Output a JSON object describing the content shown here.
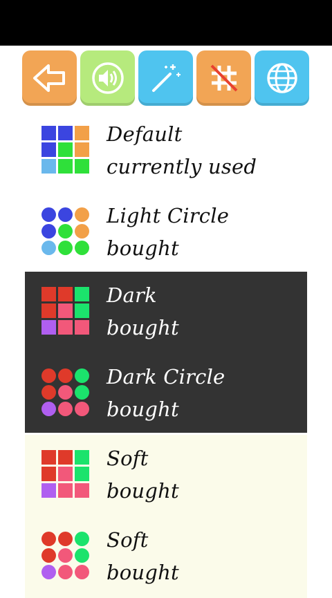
{
  "toolbar": {
    "buttons": [
      {
        "icon": "back-arrow-icon",
        "color": "#f2a555"
      },
      {
        "icon": "speaker-icon",
        "color": "#b6ea7d"
      },
      {
        "icon": "magic-wand-icon",
        "color": "#4fc4ef"
      },
      {
        "icon": "grid-off-icon",
        "color": "#f2a555"
      },
      {
        "icon": "globe-icon",
        "color": "#4fc4ef"
      }
    ]
  },
  "themes": [
    {
      "name": "Default",
      "status": "currently used",
      "shape": "square",
      "bg": "#ffffff",
      "text": "#111111",
      "colors": [
        "#3b45e0",
        "#3b45e0",
        "#f2a048",
        "#3b45e0",
        "#2fe03a",
        "#f2a048",
        "#6ab8ec",
        "#2fe03a",
        "#2fe03a"
      ]
    },
    {
      "name": "Light Circle",
      "status": "bought",
      "shape": "circle",
      "bg": "#ffffff",
      "text": "#111111",
      "colors": [
        "#3b45e0",
        "#3b45e0",
        "#f2a048",
        "#3b45e0",
        "#2fe03a",
        "#f2a048",
        "#6ab8ec",
        "#2fe03a",
        "#2fe03a"
      ]
    },
    {
      "name": "Dark",
      "status": "bought",
      "shape": "square",
      "bg": "#333333",
      "text": "#ffffff",
      "colors": [
        "#df3a2a",
        "#df3a2a",
        "#1be36c",
        "#df3a2a",
        "#f2587a",
        "#1be36c",
        "#b05ff0",
        "#f2587a",
        "#f2587a"
      ]
    },
    {
      "name": "Dark Circle",
      "status": "bought",
      "shape": "circle",
      "bg": "#333333",
      "text": "#ffffff",
      "colors": [
        "#df3a2a",
        "#df3a2a",
        "#1be36c",
        "#df3a2a",
        "#f2587a",
        "#1be36c",
        "#b05ff0",
        "#f2587a",
        "#f2587a"
      ]
    },
    {
      "name": "Soft",
      "status": "bought",
      "shape": "square",
      "bg": "#fbfbea",
      "text": "#111111",
      "colors": [
        "#df3a2a",
        "#df3a2a",
        "#1be36c",
        "#df3a2a",
        "#f2587a",
        "#1be36c",
        "#b05ff0",
        "#f2587a",
        "#f2587a"
      ]
    },
    {
      "name": "Soft",
      "status": "bought",
      "shape": "circle",
      "bg": "#fbfbea",
      "text": "#111111",
      "colors": [
        "#df3a2a",
        "#df3a2a",
        "#1be36c",
        "#df3a2a",
        "#f2587a",
        "#1be36c",
        "#b05ff0",
        "#f2587a",
        "#f2587a"
      ]
    }
  ]
}
